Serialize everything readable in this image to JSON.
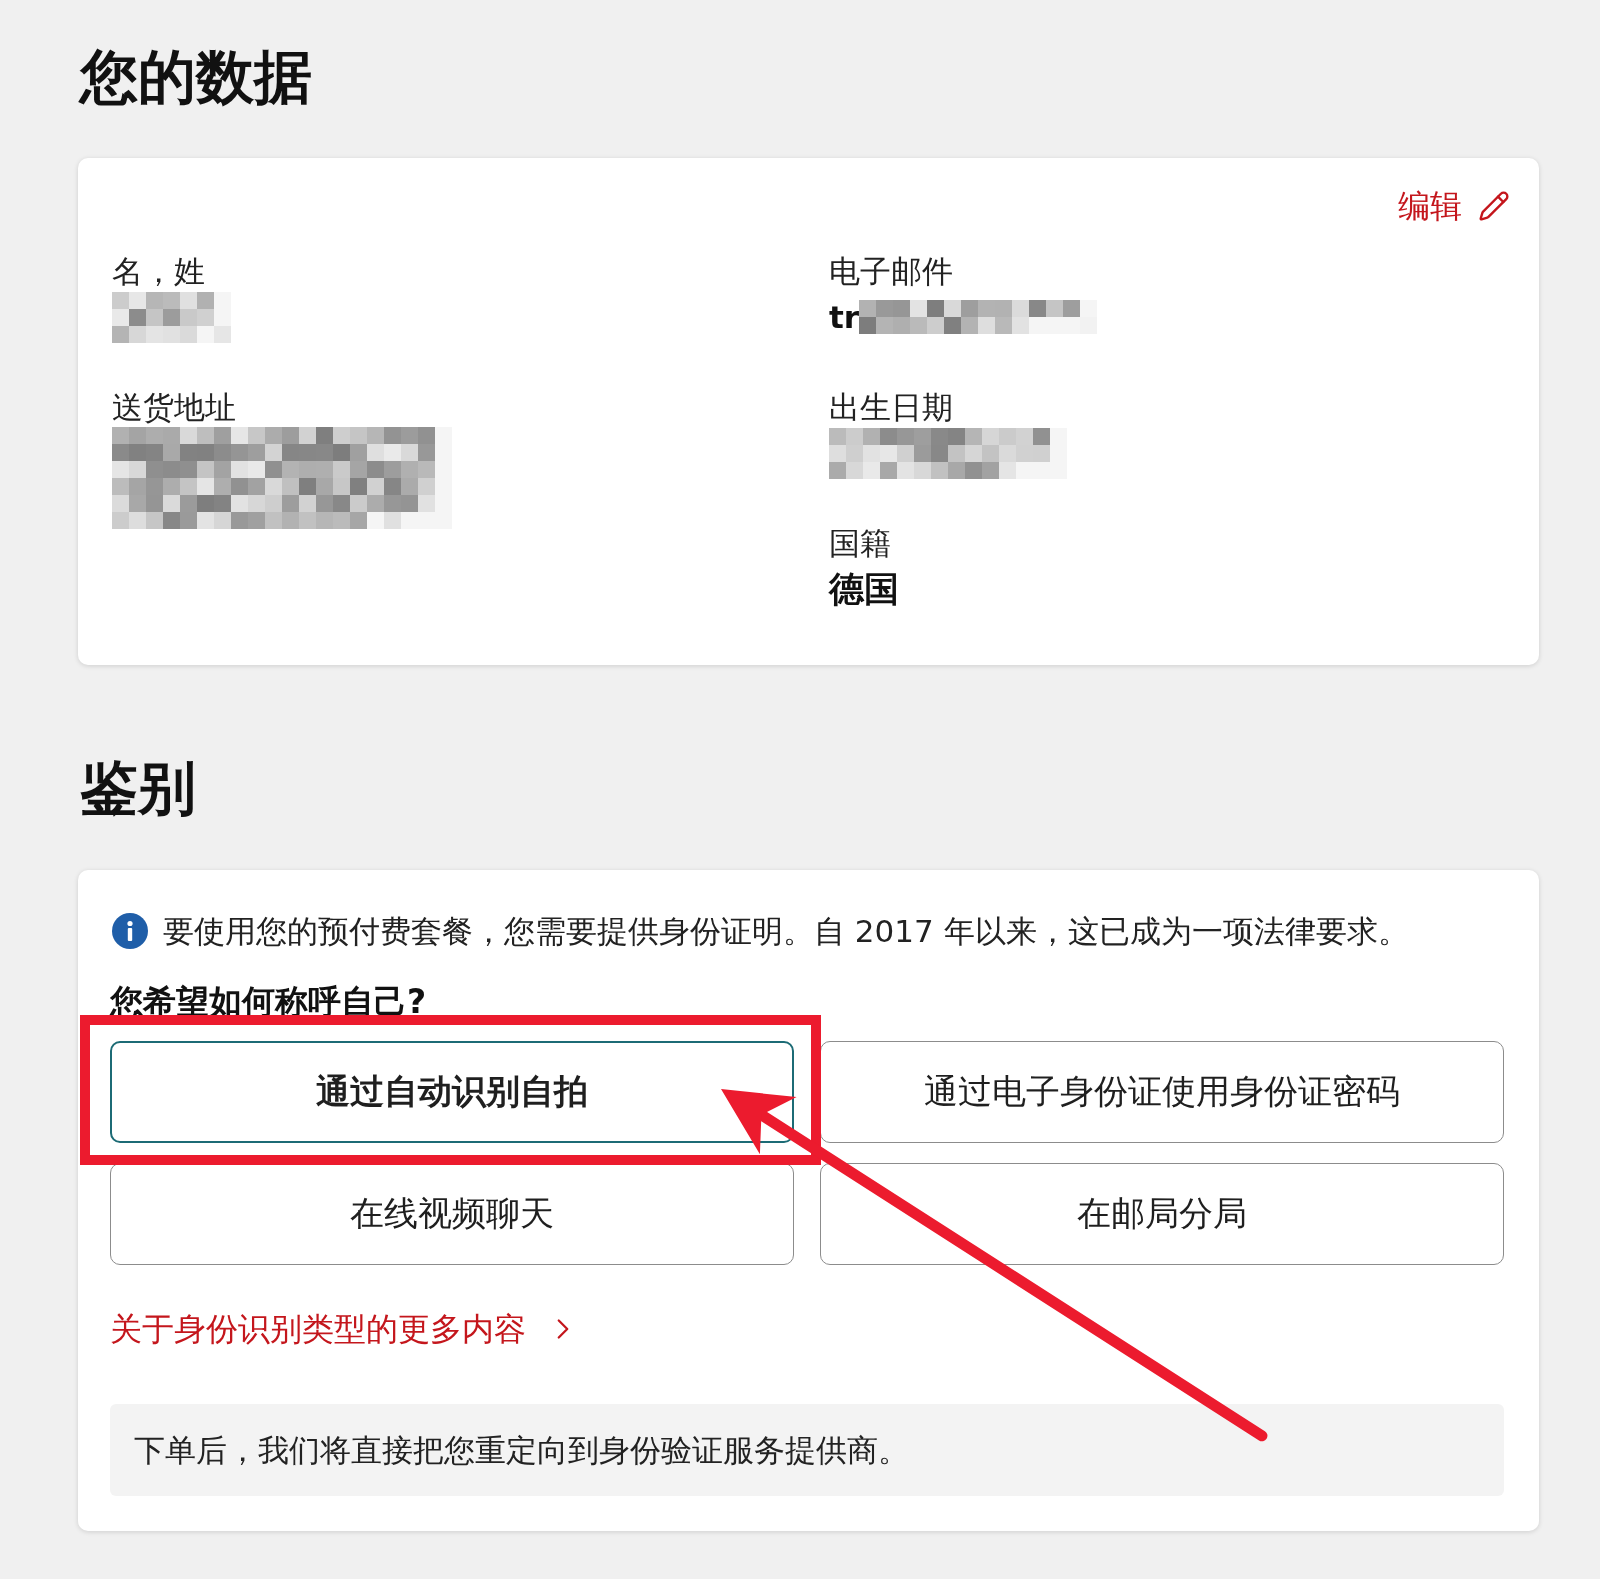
{
  "your_data": {
    "title": "您的数据",
    "edit_link": "编辑",
    "columns": [
      {
        "fields": [
          {
            "label": "名，姓",
            "kind": "hidden"
          },
          {
            "label": "送货地址",
            "kind": "hidden"
          }
        ]
      },
      {
        "fields": [
          {
            "label": "电子邮件",
            "kind": "partial",
            "value": "tr"
          },
          {
            "label": "出生日期",
            "kind": "hidden"
          },
          {
            "label": "国籍",
            "kind": "text",
            "value": "德国"
          }
        ]
      }
    ]
  },
  "identification": {
    "title": "鉴别",
    "info": "要使用您的预付费套餐，您需要提供身份证明。自 2017 年以来，这已成为一项法律要求。",
    "question": "您希望如何称呼自己?",
    "options": [
      {
        "label": "通过自动识别自拍",
        "selected": true
      },
      {
        "label": "通过电子身份证使用身份证密码",
        "selected": false
      },
      {
        "label": "在线视频聊天",
        "selected": false
      },
      {
        "label": "在邮局分局",
        "selected": false
      }
    ],
    "more_link": "关于身份识别类型的更多内容",
    "notice": "下单后，我们将直接把您重定向到身份验证服务提供商。"
  }
}
